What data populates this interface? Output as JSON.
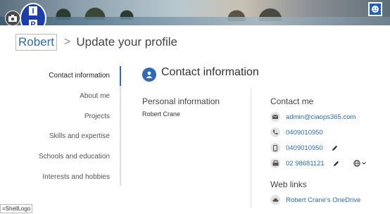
{
  "logo": {
    "letters": [
      "I",
      "P"
    ]
  },
  "breadcrumb": {
    "link": "Robert",
    "separator": ">",
    "title": "Update your profile"
  },
  "nav": {
    "items": [
      {
        "label": "Contact information",
        "active": true
      },
      {
        "label": "About me"
      },
      {
        "label": "Projects"
      },
      {
        "label": "Skills and expertise"
      },
      {
        "label": "Schools and education"
      },
      {
        "label": "Interests and hobbies"
      }
    ]
  },
  "section": {
    "title": "Contact information"
  },
  "personal": {
    "heading": "Personal information",
    "name": "Robert Crane"
  },
  "contact": {
    "heading": "Contact me",
    "email": "admin@ciaops365.com",
    "phone": "0409010950",
    "mobile": "0409010950",
    "fax": "02 98681121"
  },
  "weblinks": {
    "heading": "Web links",
    "link": "Robert Crane's OneDrive"
  },
  "statusbar": {
    "text": "=ShellLogo"
  },
  "colors": {
    "accent": "#2f6bb5",
    "logo": "#1a3fa8"
  }
}
